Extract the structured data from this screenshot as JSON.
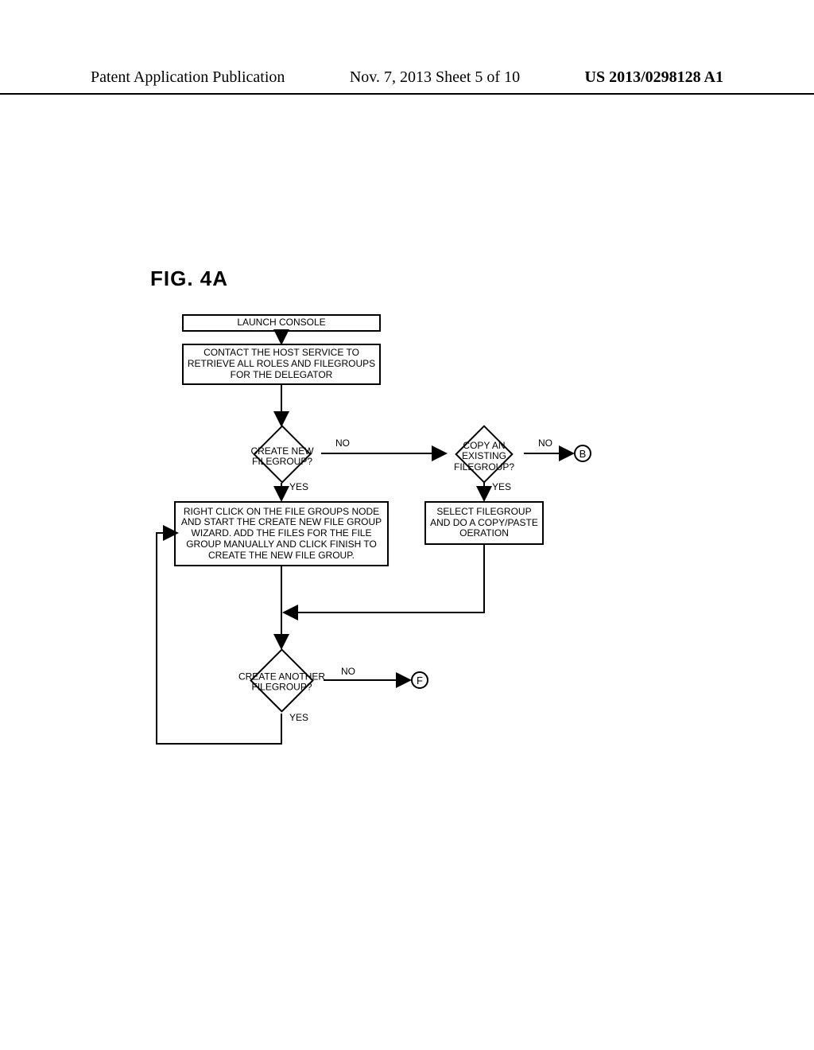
{
  "header": {
    "left": "Patent Application Publication",
    "mid": "Nov. 7, 2013   Sheet 5 of 10",
    "right": "US 2013/0298128 A1"
  },
  "figure_label": "FIG. 4A",
  "boxes": {
    "launch": "LAUNCH CONSOLE",
    "contact": "CONTACT THE HOST SERVICE TO RETRIEVE ALL ROLES AND FILEGROUPS FOR THE DELEGATOR",
    "create_wizard": "RIGHT CLICK ON THE FILE GROUPS NODE AND START THE CREATE NEW FILE GROUP WIZARD.  ADD THE FILES FOR THE FILE GROUP MANUALLY AND CLICK FINISH TO CREATE THE NEW FILE GROUP.",
    "copy_paste": "SELECT FILEGROUP AND DO A COPY/PASTE OERATION"
  },
  "decisions": {
    "create_new": "CREATE NEW FILEGROUP?",
    "copy_existing": "COPY AN EXISTING FILEGROUP?",
    "create_another": "CREATE ANOTHER FILEGROUP?"
  },
  "labels": {
    "yes": "YES",
    "no": "NO"
  },
  "connectors": {
    "b": "B",
    "f": "F"
  },
  "chart_data": {
    "type": "flowchart",
    "title": "FIG. 4A",
    "nodes": [
      {
        "id": "launch",
        "shape": "process",
        "text": "LAUNCH CONSOLE"
      },
      {
        "id": "contact",
        "shape": "process",
        "text": "CONTACT THE HOST SERVICE TO RETRIEVE ALL ROLES AND FILEGROUPS FOR THE DELEGATOR"
      },
      {
        "id": "create_new",
        "shape": "decision",
        "text": "CREATE NEW FILEGROUP?"
      },
      {
        "id": "copy_existing",
        "shape": "decision",
        "text": "COPY AN EXISTING FILEGROUP?"
      },
      {
        "id": "create_wizard",
        "shape": "process",
        "text": "RIGHT CLICK ON THE FILE GROUPS NODE AND START THE CREATE NEW FILE GROUP WIZARD. ADD THE FILES FOR THE FILE GROUP MANUALLY AND CLICK FINISH TO CREATE THE NEW FILE GROUP."
      },
      {
        "id": "copy_paste",
        "shape": "process",
        "text": "SELECT FILEGROUP AND DO A COPY/PASTE OERATION"
      },
      {
        "id": "create_another",
        "shape": "decision",
        "text": "CREATE ANOTHER FILEGROUP?"
      },
      {
        "id": "B",
        "shape": "off-page-connector",
        "text": "B"
      },
      {
        "id": "F",
        "shape": "off-page-connector",
        "text": "F"
      }
    ],
    "edges": [
      {
        "from": "launch",
        "to": "contact"
      },
      {
        "from": "contact",
        "to": "create_new"
      },
      {
        "from": "create_new",
        "to": "create_wizard",
        "label": "YES"
      },
      {
        "from": "create_new",
        "to": "copy_existing",
        "label": "NO"
      },
      {
        "from": "copy_existing",
        "to": "copy_paste",
        "label": "YES"
      },
      {
        "from": "copy_existing",
        "to": "B",
        "label": "NO"
      },
      {
        "from": "create_wizard",
        "to": "create_another"
      },
      {
        "from": "copy_paste",
        "to": "create_another"
      },
      {
        "from": "create_another",
        "to": "F",
        "label": "NO"
      },
      {
        "from": "create_another",
        "to": "create_new",
        "label": "YES",
        "note": "loop back"
      }
    ]
  }
}
